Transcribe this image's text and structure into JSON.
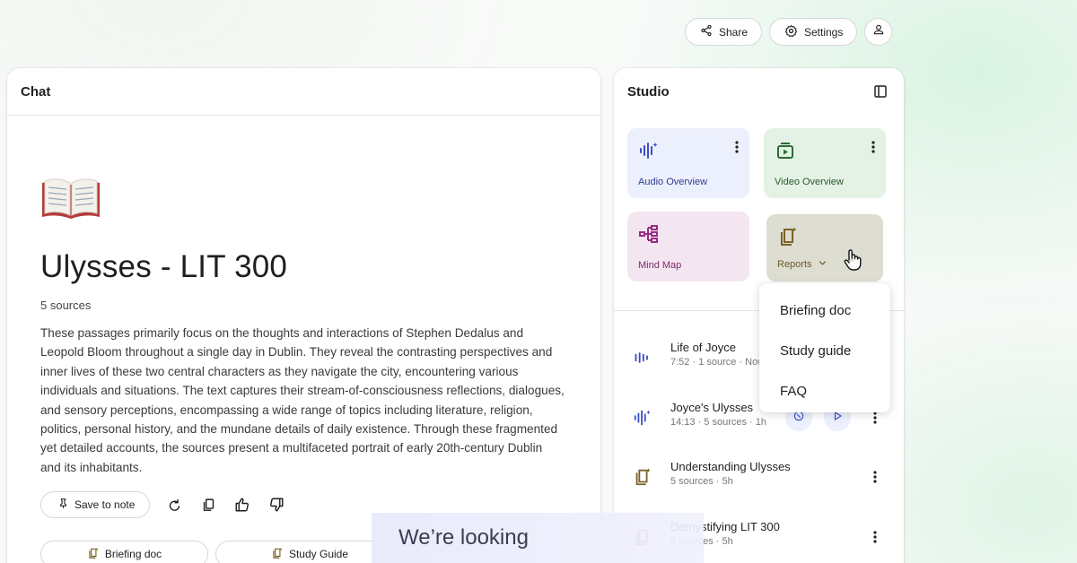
{
  "header": {
    "share_label": "Share",
    "settings_label": "Settings"
  },
  "chat": {
    "title": "Chat",
    "notebook_emoji": "📖",
    "notebook_title": "Ulysses - LIT 300",
    "sources_count": "5 sources",
    "summary": "These passages primarily focus on the thoughts and interactions of Stephen Dedalus and Leopold Bloom throughout a single day in Dublin. They reveal the contrasting perspectives and inner lives of these two central characters as they navigate the city, encountering various individuals and situations. The text captures their stream-of-consciousness reflections, dialogues, and sensory perceptions, encompassing a wide range of topics including literature, religion, politics, personal history, and the mundane details of daily existence. Through these fragmented yet detailed accounts, the sources present a multifaceted portrait of early 20th-century Dublin and its inhabitants.",
    "save_to_note_label": "Save to note",
    "suggestions": [
      "Briefing doc",
      "Study Guide"
    ]
  },
  "studio": {
    "title": "Studio",
    "cards": {
      "audio": "Audio Overview",
      "video": "Video Overview",
      "mind_map": "Mind Map",
      "reports": "Reports"
    },
    "notes": [
      {
        "title": "Life of Joyce",
        "subtitle": "7:52 · 1 source · Now"
      },
      {
        "title": "Joyce's Ulysses",
        "subtitle": "14:13 · 5 sources · 1h"
      },
      {
        "title": "Understanding Ulysses",
        "subtitle": "5 sources · 5h"
      },
      {
        "title": "Demystifying LIT 300",
        "subtitle": "5 sources · 5h"
      }
    ]
  },
  "reports_menu": {
    "items": [
      "Briefing doc",
      "Study guide",
      "FAQ"
    ]
  },
  "caption": "We’re looking",
  "colors": {
    "audio_card": "#eceffc",
    "video_card": "#e3f2e4",
    "mind_map_card": "#f4e6f0",
    "reports_card": "#ddddd2",
    "audio_icon": "#3b4fc4",
    "video_icon": "#2e6b35",
    "mind_map_icon": "#9b2a86",
    "reports_icon": "#7a6326"
  }
}
